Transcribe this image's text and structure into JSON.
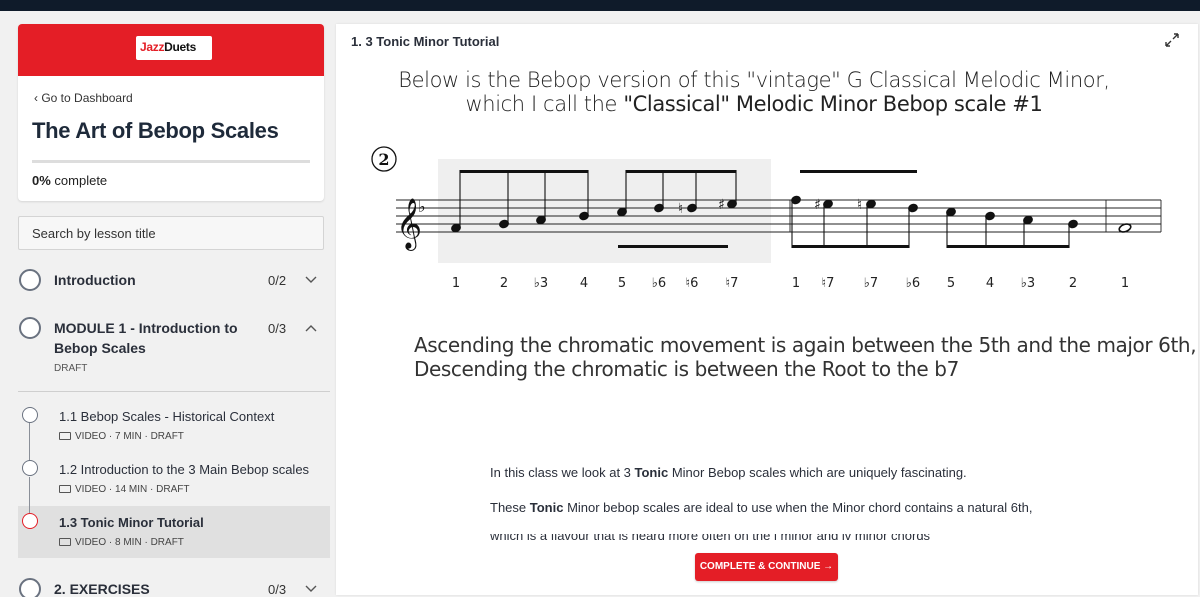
{
  "sidebar": {
    "brand": {
      "logo_text": "Jazz Duets"
    },
    "back_label": "Go to Dashboard",
    "course_title": "The Art of Bebop Scales",
    "progress_percent": 0,
    "progress_label": "0% complete",
    "search_placeholder": "Search by lesson title",
    "modules": [
      {
        "title": "Introduction",
        "count": "0/2",
        "chevron": "chevron-down"
      },
      {
        "title": "MODULE 1 - Introduction to Bebop Scales",
        "title_line1": "MODULE 1 - Introduction to",
        "title_line2": "Bebop Scales",
        "count": "0/3",
        "status": "DRAFT",
        "chevron": "chevron-up"
      },
      {
        "title": "2. EXERCISES",
        "count": "0/3",
        "chevron": "chevron-down"
      }
    ],
    "lessons": [
      {
        "title": "1.1 Bebop Scales - Historical Context",
        "type": "VIDEO",
        "duration": "7 MIN",
        "status": "DRAFT"
      },
      {
        "title": "1.2 Introduction to the 3 Main Bebop scales",
        "type": "VIDEO",
        "duration": "14 MIN",
        "status": "DRAFT"
      },
      {
        "title": "1.3 Tonic Minor Tutorial",
        "type": "VIDEO",
        "duration": "8 MIN",
        "status": "DRAFT"
      }
    ]
  },
  "main": {
    "heading": "1. 3 Tonic Minor Tutorial",
    "intro_line1": "Below is the Bebop version of this \"vintage\"  G Classical Melodic Minor,",
    "intro_line2_pre": "which I call the ",
    "intro_line2_bold": "\"Classical\"  Melodic Minor Bebop scale #1",
    "exercise_number": "2",
    "degrees": [
      "1",
      "2",
      "♭3",
      "4",
      "5",
      "♭6",
      "♮6",
      "♮7",
      "1",
      "♮7",
      "♭7",
      "♭6",
      "5",
      "4",
      "♭3",
      "2",
      "1"
    ],
    "desc_line1": "Ascending the chromatic movement is again between the 5th and the major 6th,",
    "desc_line2": "Descending the chromatic is between the Root to the b7",
    "p1_pre": "In this class we look at 3 ",
    "p1_bold": "Tonic",
    "p1_post": " Minor Bebop scales which are uniquely fascinating.",
    "p2_pre": "These ",
    "p2_bold": "Tonic",
    "p2_post": " Minor bebop scales are ideal to use when the  Minor chord contains a natural 6th,",
    "p3_cut": "which is a flavour that is heard more often on the i minor and iv minor chords",
    "cta_label": "COMPLETE & CONTINUE →",
    "colors": {
      "brand_red": "#e41e26",
      "ink": "#222222"
    }
  }
}
